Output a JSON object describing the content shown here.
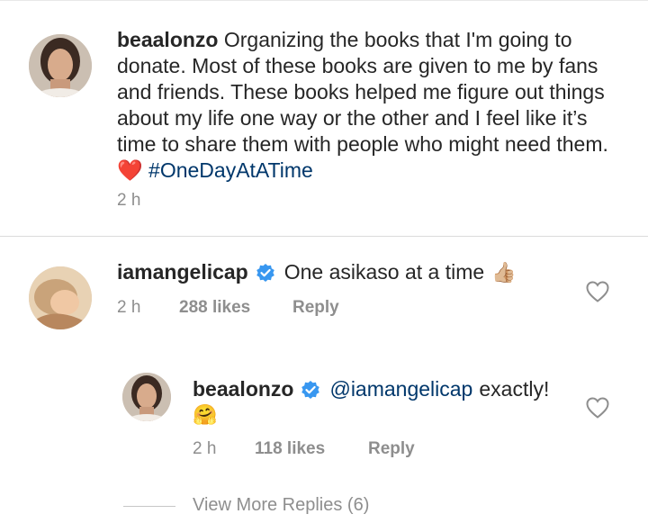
{
  "caption": {
    "username": "beaalonzo",
    "text": "Organizing the books that I'm going to donate. Most of these books are given to me by fans and friends. These books helped me figure out things about my life one way or the other and I feel like it’s time to share them with people who might need them.",
    "heart_emoji": "❤️",
    "hashtag": "#OneDayAtATime",
    "time": "2 h"
  },
  "comments": [
    {
      "username": "iamangelicap",
      "verified": true,
      "text": "One asikaso at a time",
      "emoji": "👍🏼",
      "time": "2 h",
      "likes": "288 likes",
      "reply_label": "Reply"
    },
    {
      "username": "beaalonzo",
      "verified": true,
      "mention": "@iamangelicap",
      "text": "exactly!",
      "emoji": "🤗",
      "time": "2 h",
      "likes": "118 likes",
      "reply_label": "Reply"
    }
  ],
  "view_more_replies": "View More Replies (6)",
  "icons": {
    "verified": "verified-badge-icon",
    "like": "heart-outline-icon"
  },
  "colors": {
    "text": "#262626",
    "muted": "#8e8e8e",
    "link": "#00376b",
    "verified": "#3897f0",
    "heart": "#e0262b"
  }
}
